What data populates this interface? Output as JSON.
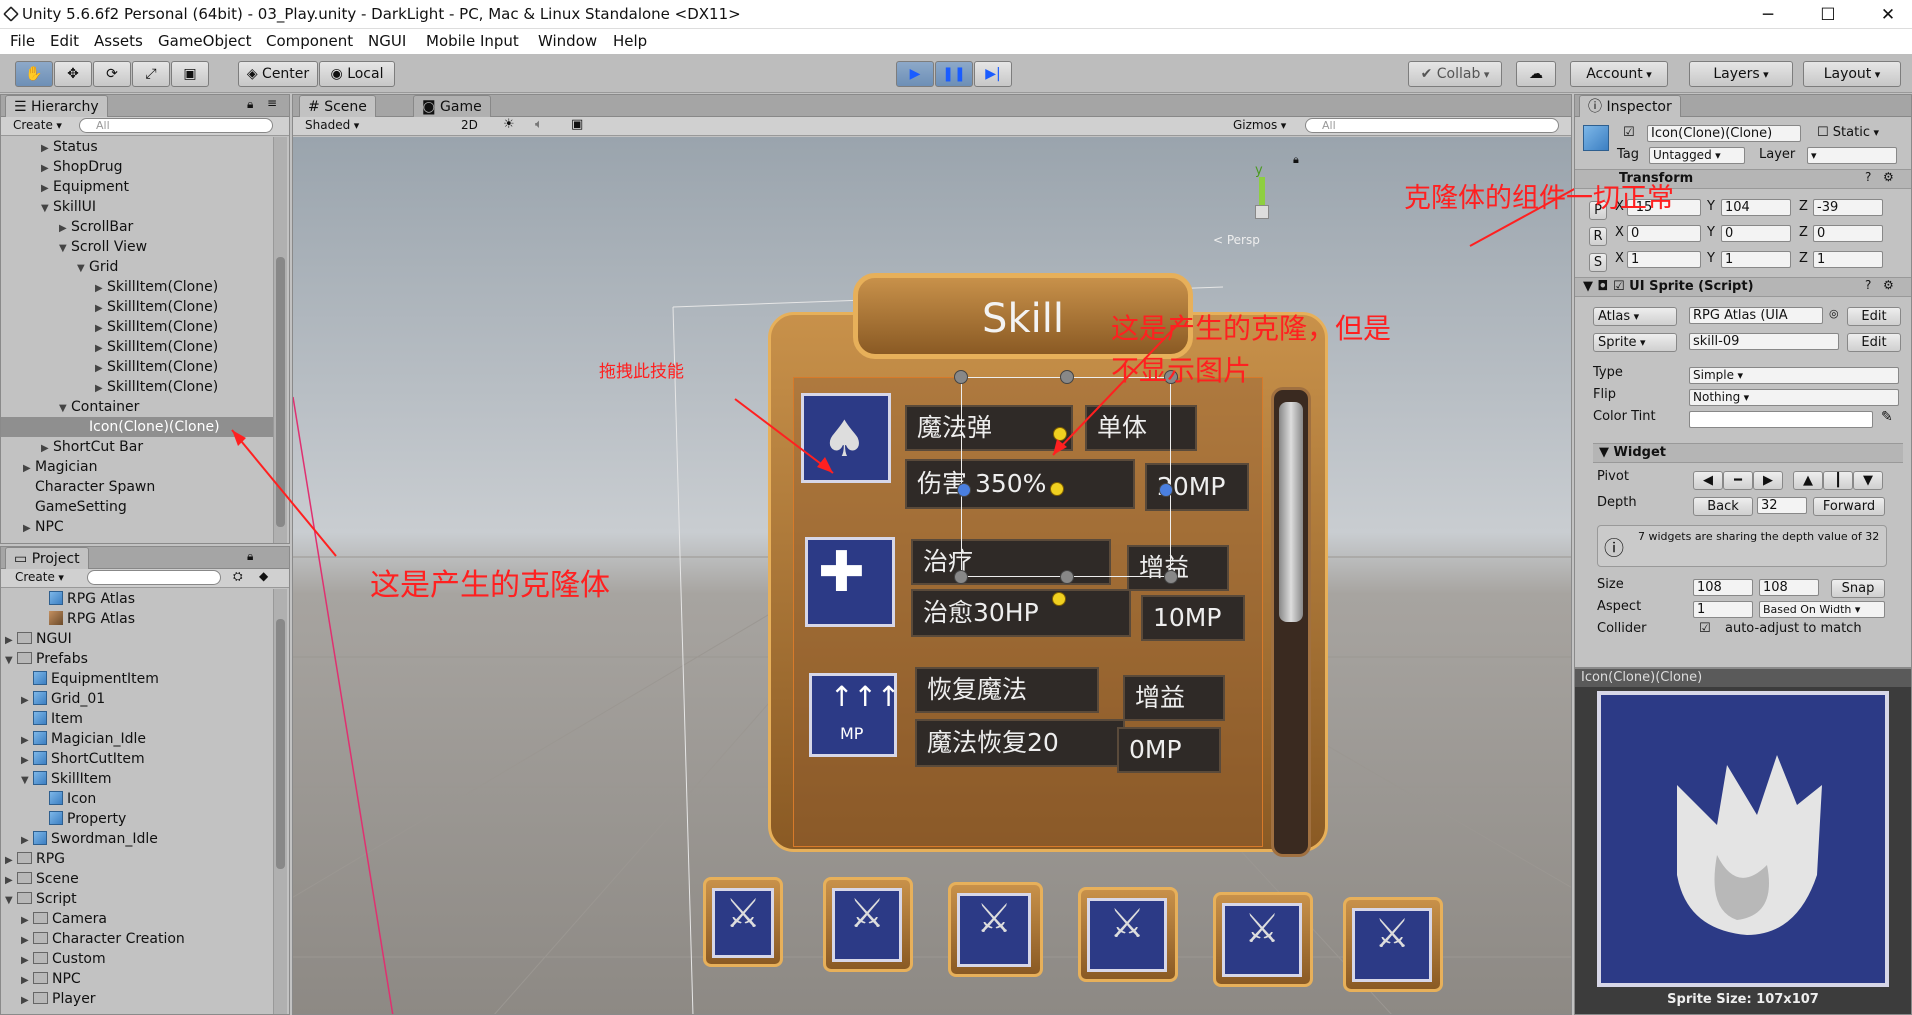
{
  "window": {
    "title": "Unity 5.6.6f2 Personal (64bit) - 03_Play.unity - DarkLight - PC, Mac & Linux Standalone <DX11>",
    "minimize": "─",
    "maximize": "☐",
    "close": "✕"
  },
  "menu": [
    "File",
    "Edit",
    "Assets",
    "GameObject",
    "Component",
    "NGUI",
    "Mobile Input",
    "Window",
    "Help"
  ],
  "toolbar": {
    "center": "Center",
    "local": "Local",
    "collab": "Collab",
    "account": "Account",
    "layers": "Layers",
    "layout": "Layout"
  },
  "hierarchy": {
    "tab": "Hierarchy",
    "create": "Create",
    "search_placeholder": "All",
    "items": [
      {
        "label": "Status",
        "indent": 2,
        "arrow": "▶"
      },
      {
        "label": "ShopDrug",
        "indent": 2,
        "arrow": "▶"
      },
      {
        "label": "Equipment",
        "indent": 2,
        "arrow": "▶"
      },
      {
        "label": "SkillUI",
        "indent": 2,
        "arrow": "▼"
      },
      {
        "label": "ScrollBar",
        "indent": 3,
        "arrow": "▶"
      },
      {
        "label": "Scroll View",
        "indent": 3,
        "arrow": "▼"
      },
      {
        "label": "Grid",
        "indent": 4,
        "arrow": "▼"
      },
      {
        "label": "SkillItem(Clone)",
        "indent": 5,
        "arrow": "▶"
      },
      {
        "label": "SkillItem(Clone)",
        "indent": 5,
        "arrow": "▶"
      },
      {
        "label": "SkillItem(Clone)",
        "indent": 5,
        "arrow": "▶"
      },
      {
        "label": "SkillItem(Clone)",
        "indent": 5,
        "arrow": "▶"
      },
      {
        "label": "SkillItem(Clone)",
        "indent": 5,
        "arrow": "▶"
      },
      {
        "label": "SkillItem(Clone)",
        "indent": 5,
        "arrow": "▶"
      },
      {
        "label": "Container",
        "indent": 3,
        "arrow": "▼"
      },
      {
        "label": "Icon(Clone)(Clone)",
        "indent": 4,
        "arrow": "",
        "selected": true
      },
      {
        "label": "ShortCut Bar",
        "indent": 2,
        "arrow": "▶"
      },
      {
        "label": "Magician",
        "indent": 1,
        "arrow": "▶"
      },
      {
        "label": "Character Spawn",
        "indent": 1,
        "arrow": ""
      },
      {
        "label": "GameSetting",
        "indent": 1,
        "arrow": ""
      },
      {
        "label": "NPC",
        "indent": 1,
        "arrow": "▶"
      }
    ]
  },
  "project": {
    "tab": "Project",
    "create": "Create",
    "items": [
      {
        "label": "RPG Atlas",
        "indent": 2,
        "arrow": "",
        "icon": "cube"
      },
      {
        "label": "RPG Atlas",
        "indent": 2,
        "arrow": "",
        "icon": "atlas"
      },
      {
        "label": "NGUI",
        "indent": 0,
        "arrow": "▶",
        "icon": "folder"
      },
      {
        "label": "Prefabs",
        "indent": 0,
        "arrow": "▼",
        "icon": "folder"
      },
      {
        "label": "EquipmentItem",
        "indent": 1,
        "arrow": "",
        "icon": "cube"
      },
      {
        "label": "Grid_01",
        "indent": 1,
        "arrow": "▶",
        "icon": "cube"
      },
      {
        "label": "Item",
        "indent": 1,
        "arrow": "",
        "icon": "cube"
      },
      {
        "label": "Magician_Idle",
        "indent": 1,
        "arrow": "▶",
        "icon": "cube"
      },
      {
        "label": "ShortCutItem",
        "indent": 1,
        "arrow": "▶",
        "icon": "cube"
      },
      {
        "label": "SkillItem",
        "indent": 1,
        "arrow": "▼",
        "icon": "cube"
      },
      {
        "label": "Icon",
        "indent": 2,
        "arrow": "",
        "icon": "cube"
      },
      {
        "label": "Property",
        "indent": 2,
        "arrow": "",
        "icon": "cube"
      },
      {
        "label": "Swordman_Idle",
        "indent": 1,
        "arrow": "▶",
        "icon": "cube"
      },
      {
        "label": "RPG",
        "indent": 0,
        "arrow": "▶",
        "icon": "folder"
      },
      {
        "label": "Scene",
        "indent": 0,
        "arrow": "▶",
        "icon": "folder"
      },
      {
        "label": "Script",
        "indent": 0,
        "arrow": "▼",
        "icon": "folder"
      },
      {
        "label": "Camera",
        "indent": 1,
        "arrow": "▶",
        "icon": "folder"
      },
      {
        "label": "Character Creation",
        "indent": 1,
        "arrow": "▶",
        "icon": "folder"
      },
      {
        "label": "Custom",
        "indent": 1,
        "arrow": "▶",
        "icon": "folder"
      },
      {
        "label": "NPC",
        "indent": 1,
        "arrow": "▶",
        "icon": "folder"
      },
      {
        "label": "Player",
        "indent": 1,
        "arrow": "▶",
        "icon": "folder"
      }
    ]
  },
  "scene": {
    "tab_scene": "Scene",
    "tab_game": "Game",
    "shaded": "Shaded",
    "mode2d": "2D",
    "gizmos": "Gizmos",
    "search_placeholder": "All",
    "persp": "< Persp",
    "gizmo_y": "y",
    "skill_title": "Skill",
    "skills": [
      {
        "name": "魔法弹",
        "type": "单体",
        "desc": "伤害 350%",
        "cost": "20MP"
      },
      {
        "name": "治疗",
        "type": "增益",
        "desc": "治愈30HP",
        "cost": "10MP"
      },
      {
        "name": "恢复魔法",
        "type": "增益",
        "desc": "魔法恢复20",
        "cost": "0MP"
      }
    ],
    "mp_icon_label": "MP"
  },
  "annotations": {
    "drag": "拖拽此技能",
    "clone_created": "这是产生的克隆体",
    "clone_no_image_1": "这是产生的克隆，但是",
    "clone_no_image_2": "不显示图片",
    "components_ok": "克隆体的组件一切正常"
  },
  "inspector": {
    "tab": "Inspector",
    "object_name": "Icon(Clone)(Clone)",
    "static": "Static",
    "tag_label": "Tag",
    "tag_value": "Untagged",
    "layer_label": "Layer",
    "transform": {
      "title": "Transform",
      "P": {
        "x": "-15",
        "y": "104",
        "z": "-39"
      },
      "R": {
        "x": "0",
        "y": "0",
        "z": "0"
      },
      "S": {
        "x": "1",
        "y": "1",
        "z": "1"
      }
    },
    "uisprite": {
      "title": "UI Sprite (Script)",
      "atlas_label": "Atlas",
      "atlas_value": "RPG Atlas (UIA",
      "sprite_label": "Sprite",
      "sprite_value": "skill-09",
      "edit": "Edit",
      "type_label": "Type",
      "type_value": "Simple",
      "flip_label": "Flip",
      "flip_value": "Nothing",
      "tint_label": "Color Tint"
    },
    "widget": {
      "title": "Widget",
      "pivot_label": "Pivot",
      "depth_label": "Depth",
      "back": "Back",
      "depth_value": "32",
      "forward": "Forward",
      "info": "7 widgets are sharing the depth value of 32",
      "size_label": "Size",
      "w": "108",
      "h": "108",
      "snap": "Snap",
      "aspect_label": "Aspect",
      "aspect_value": "1",
      "aspect_mode": "Based On Width",
      "collider_label": "Collider",
      "collider_text": "auto-adjust to match"
    },
    "preview_title": "Icon(Clone)(Clone)",
    "sprite_size": "Sprite Size: 107x107"
  },
  "colors": {
    "annotation": "#ff2020",
    "play_active": "#6d8fb6",
    "skill_icon_bg": "#2c3a86"
  }
}
